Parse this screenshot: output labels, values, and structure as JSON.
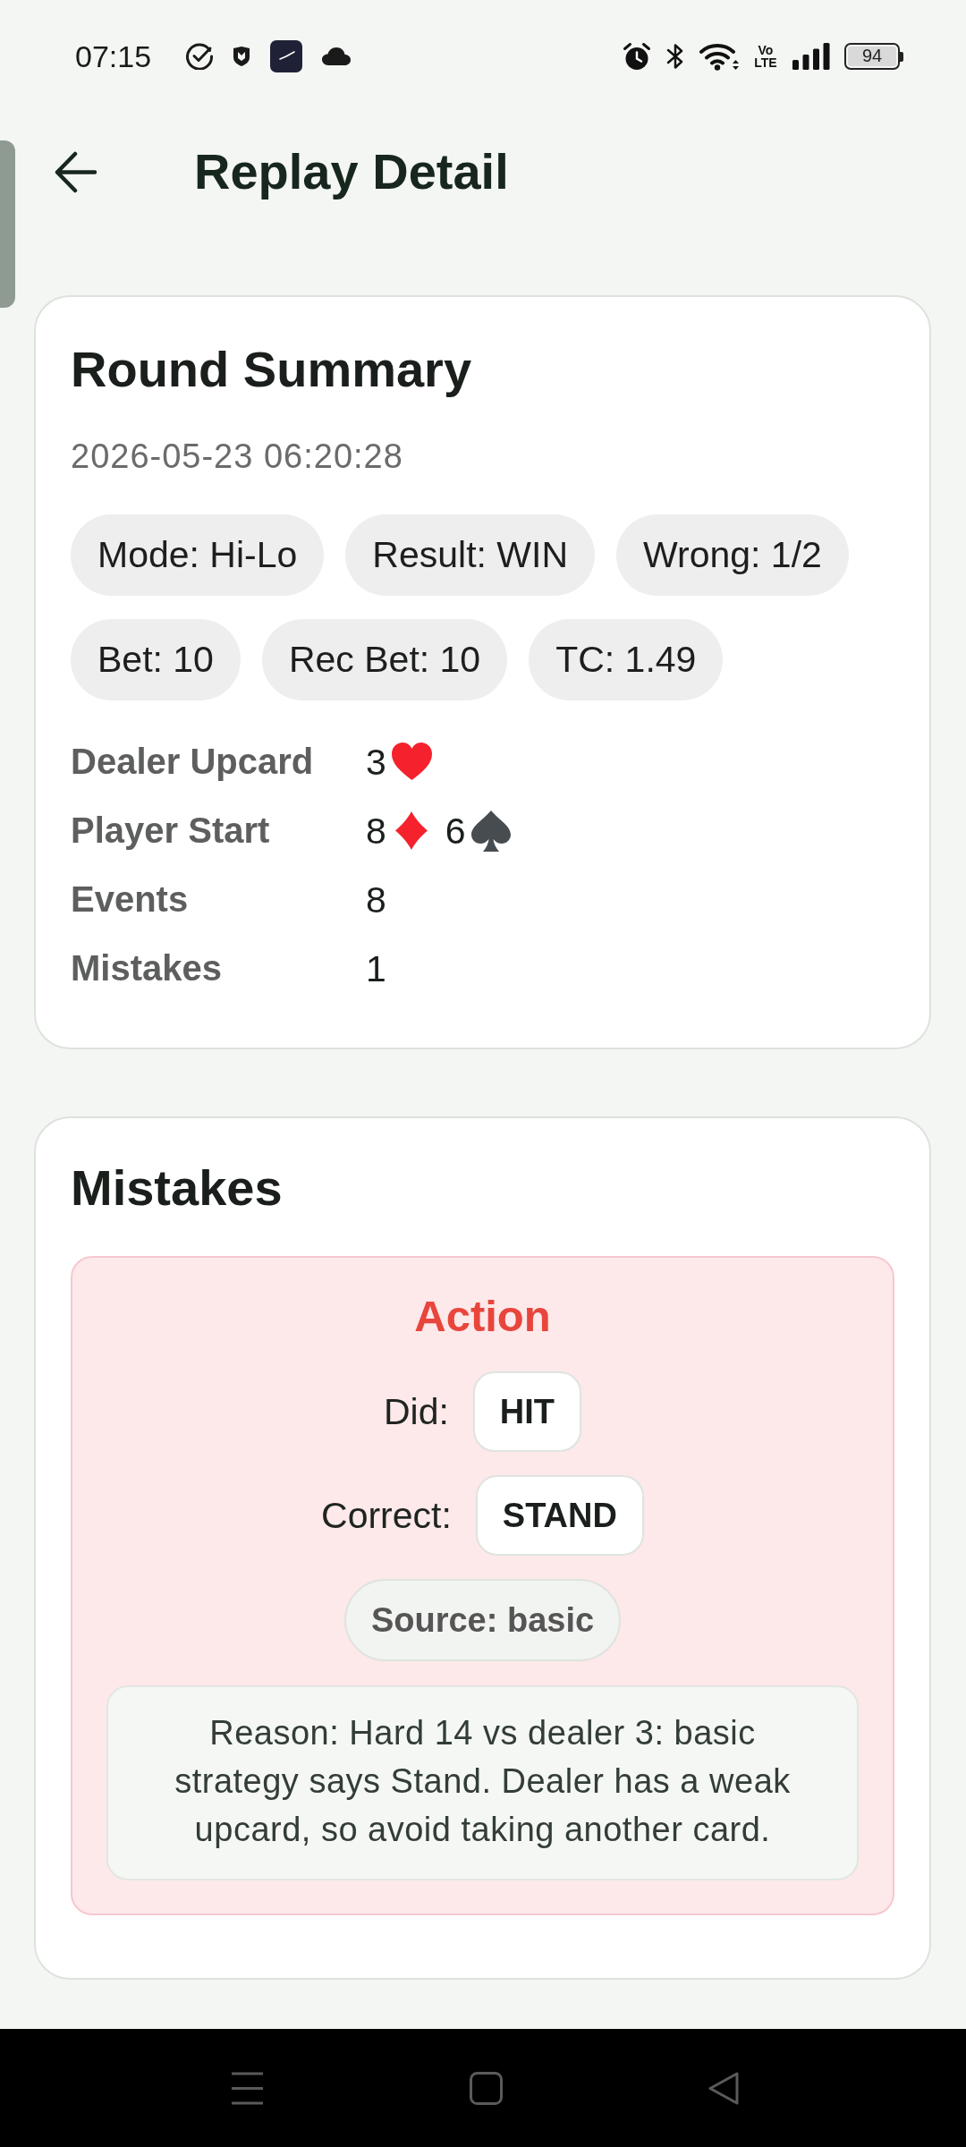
{
  "status_bar": {
    "time": "07:15",
    "network_label": "Vo LTE",
    "battery": "94"
  },
  "header": {
    "title": "Replay Detail"
  },
  "summary": {
    "title": "Round Summary",
    "timestamp": "2026-05-23 06:20:28",
    "chips": [
      "Mode: Hi-Lo",
      "Result: WIN",
      "Wrong: 1/2",
      "Bet: 10",
      "Rec Bet: 10",
      "TC: 1.49"
    ],
    "rows": [
      {
        "label": "Dealer Upcard",
        "kind": "cards",
        "cards": [
          {
            "rank": "3",
            "kind": "heart"
          }
        ]
      },
      {
        "label": "Player Start",
        "kind": "cards",
        "cards": [
          {
            "rank": "8",
            "kind": "diamond"
          },
          {
            "rank": "6",
            "kind": "spade"
          }
        ]
      },
      {
        "label": "Events",
        "kind": "text",
        "value": "8"
      },
      {
        "label": "Mistakes",
        "kind": "text",
        "value": "1"
      }
    ]
  },
  "mistakes": {
    "title": "Mistakes",
    "items": [
      {
        "type": "Action",
        "did_label": "Did:",
        "did": "HIT",
        "correct_label": "Correct:",
        "correct": "STAND",
        "source": "Source: basic",
        "reason": "Reason: Hard 14 vs dealer 3: basic strategy says Stand. Dealer has a weak upcard, so avoid taking another card."
      }
    ]
  }
}
